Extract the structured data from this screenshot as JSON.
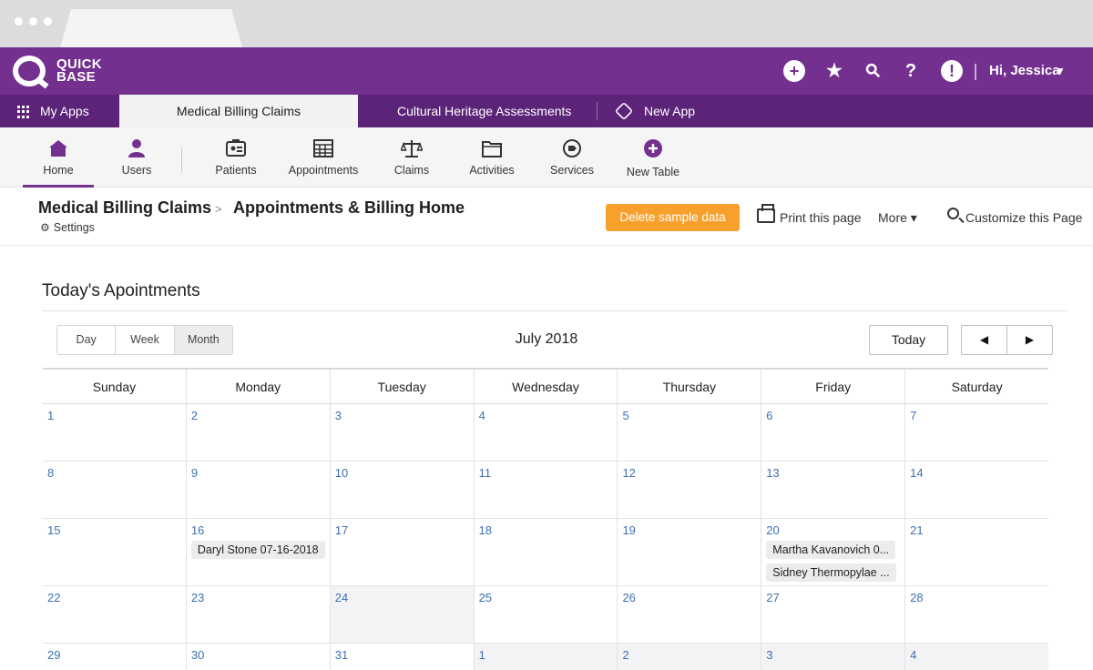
{
  "brand": {
    "line1": "QUICK",
    "line2": "BASE"
  },
  "topbar": {
    "icons": [
      {
        "name": "add-icon",
        "glyph": "+"
      },
      {
        "name": "star-icon",
        "glyph": "★"
      },
      {
        "name": "search-icon",
        "glyph": "⚲"
      },
      {
        "name": "help-icon",
        "glyph": "?"
      },
      {
        "name": "alert-icon",
        "glyph": "!"
      }
    ],
    "greeting": "Hi, Jessica",
    "accent_color": "#73308f"
  },
  "apptabs": {
    "my_apps": "My Apps",
    "active": "Medical Billing Claims",
    "other": "Cultural Heritage Assessments",
    "new_app": "New App"
  },
  "tablenav": {
    "items": [
      {
        "label": "Home",
        "icon": "home-icon"
      },
      {
        "label": "Users",
        "icon": "user-icon"
      },
      {
        "label": "Patients",
        "icon": "id-card-icon"
      },
      {
        "label": "Appointments",
        "icon": "calendar-grid-icon"
      },
      {
        "label": "Claims",
        "icon": "scales-icon"
      },
      {
        "label": "Activities",
        "icon": "folder-icon"
      },
      {
        "label": "Services",
        "icon": "tag-icon"
      },
      {
        "label": "New Table",
        "icon": "plus-circle-icon"
      }
    ]
  },
  "header": {
    "crumb_app": "Medical Billing Claims",
    "crumb_sep": ">",
    "crumb_page": "Appointments & Billing Home",
    "settings": "Settings",
    "delete_btn": "Delete sample data",
    "print": "Print this page",
    "more": "More ▾",
    "customize": "Customize this Page"
  },
  "section": {
    "title": "Today's Apointments"
  },
  "calendar": {
    "views": [
      "Day",
      "Week",
      "Month"
    ],
    "selected_view": "Month",
    "month_label": "July 2018",
    "today_btn": "Today",
    "prev": "◀",
    "next": "▶",
    "weekdays": [
      "Sunday",
      "Monday",
      "Tuesday",
      "Wednesday",
      "Thursday",
      "Friday",
      "Saturday"
    ],
    "weeks": [
      [
        {
          "d": "1"
        },
        {
          "d": "2"
        },
        {
          "d": "3"
        },
        {
          "d": "4"
        },
        {
          "d": "5"
        },
        {
          "d": "6"
        },
        {
          "d": "7"
        }
      ],
      [
        {
          "d": "8"
        },
        {
          "d": "9"
        },
        {
          "d": "10"
        },
        {
          "d": "11"
        },
        {
          "d": "12"
        },
        {
          "d": "13"
        },
        {
          "d": "14"
        }
      ],
      [
        {
          "d": "15"
        },
        {
          "d": "16",
          "events": [
            "Daryl Stone 07-16-2018"
          ]
        },
        {
          "d": "17"
        },
        {
          "d": "18"
        },
        {
          "d": "19"
        },
        {
          "d": "20",
          "events": [
            "Martha Kavanovich 0...",
            "Sidney Thermopylae ..."
          ]
        },
        {
          "d": "21"
        }
      ],
      [
        {
          "d": "22"
        },
        {
          "d": "23"
        },
        {
          "d": "24",
          "shade": true
        },
        {
          "d": "25"
        },
        {
          "d": "26"
        },
        {
          "d": "27"
        },
        {
          "d": "28"
        }
      ],
      [
        {
          "d": "29"
        },
        {
          "d": "30"
        },
        {
          "d": "31"
        },
        {
          "d": "1",
          "shade": true
        },
        {
          "d": "2",
          "shade": true
        },
        {
          "d": "3",
          "shade": true
        },
        {
          "d": "4",
          "shade": true
        }
      ]
    ]
  }
}
